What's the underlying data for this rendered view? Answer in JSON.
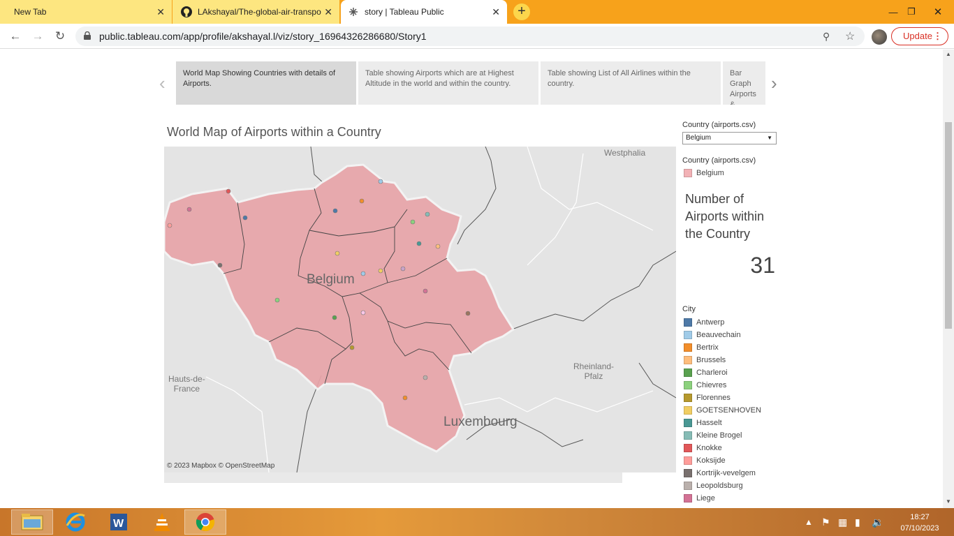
{
  "browser": {
    "tabs": [
      {
        "title": "New Tab",
        "active": false
      },
      {
        "title": "LAkshayal/The-global-air-transpo",
        "active": false
      },
      {
        "title": "story | Tableau Public",
        "active": true
      }
    ],
    "new_tab_symbol": "+",
    "close_symbol": "✕",
    "url": "public.tableau.com/app/profile/akshayal.l/viz/story_16964326286680/Story1",
    "update_label": "Update"
  },
  "story": {
    "points": [
      {
        "label": "World Map Showing Countries with details of Airports.",
        "selected": true
      },
      {
        "label": "Table showing Airports which are at Highest Altitude in the world and within the country.",
        "selected": false
      },
      {
        "label": "Table showing List of All Airlines within the country.",
        "selected": false
      },
      {
        "label": "Bar Graph Airports &",
        "selected": false
      }
    ]
  },
  "viz": {
    "title": "World Map of Airports within a Country",
    "map_labels": {
      "westphalia": "Westphalia",
      "belgium": "Belgium",
      "hauts_de_france": "Hauts-de-\nFrance",
      "rheinland_pfalz": "Rheinland-\nPfalz",
      "luxembourg": "Luxembourg"
    },
    "attribution": "© 2023 Mapbox  © OpenStreetMap"
  },
  "panel": {
    "filter_label": "Country (airports.csv)",
    "filter_value": "Belgium",
    "color_legend_label": "Country (airports.csv)",
    "color_legend_value": "Belgium",
    "country_color": "#f2b2b6",
    "kpi_title": "Number of Airports within the Country",
    "kpi_value": "31",
    "city_legend_label": "City",
    "cities": [
      {
        "name": "Antwerp",
        "color": "#4e79a7"
      },
      {
        "name": "Beauvechain",
        "color": "#a0cbe8"
      },
      {
        "name": "Bertrix",
        "color": "#f28e2b"
      },
      {
        "name": "Brussels",
        "color": "#ffbe7d"
      },
      {
        "name": "Charleroi",
        "color": "#59a14f"
      },
      {
        "name": "Chievres",
        "color": "#8cd17d"
      },
      {
        "name": "Florennes",
        "color": "#b6992d"
      },
      {
        "name": "GOETSENHOVEN",
        "color": "#f1ce63"
      },
      {
        "name": "Hasselt",
        "color": "#499894"
      },
      {
        "name": "Kleine Brogel",
        "color": "#86bcb6"
      },
      {
        "name": "Knokke",
        "color": "#e15759"
      },
      {
        "name": "Koksijde",
        "color": "#ff9d9a"
      },
      {
        "name": "Kortrijk-vevelgem",
        "color": "#79706e"
      },
      {
        "name": "Leopoldsburg",
        "color": "#bab0ac"
      },
      {
        "name": "Liege",
        "color": "#d37295"
      }
    ]
  },
  "taskbar": {
    "apps": [
      "file-explorer-icon",
      "internet-explorer-icon",
      "word-icon",
      "vlc-icon",
      "chrome-icon"
    ],
    "time": "18:27",
    "date": "07/10/2023"
  }
}
